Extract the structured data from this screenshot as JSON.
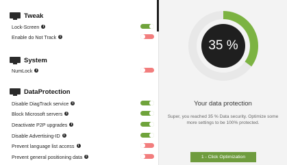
{
  "colors": {
    "toggle_on": "#6fa33b",
    "toggle_off": "#f27d7d",
    "gauge_track": "#e8e8e8",
    "gauge_fill": "#7cb342",
    "gauge_center": "#1f1f1f",
    "button": "#6f9c3e"
  },
  "icons": {
    "section": "monitor-icon",
    "info": "info-icon"
  },
  "sections": [
    {
      "title": "Tweak",
      "settings": [
        {
          "label": "Lock-Screen",
          "enabled": true
        },
        {
          "label": "Enable do Not Track",
          "enabled": false
        }
      ]
    },
    {
      "title": "System",
      "settings": [
        {
          "label": "NumLock",
          "enabled": false
        }
      ]
    },
    {
      "title": "DataProtection",
      "settings": [
        {
          "label": "Disable DiagTrack service",
          "enabled": true
        },
        {
          "label": "Block Microsoft servers",
          "enabled": true
        },
        {
          "label": "Deactivate P2P upgrades",
          "enabled": true
        },
        {
          "label": "Disable Advertising-ID",
          "enabled": true
        },
        {
          "label": "Prevent language list access",
          "enabled": false
        },
        {
          "label": "Prevent general positioning data",
          "enabled": false
        }
      ]
    }
  ],
  "protection": {
    "percent": 35,
    "percent_label": "35 %",
    "title": "Your data protection",
    "description": "Super, you reached 35 % Data security. Optimize some more settings to be 100% protected.",
    "button_label": "1 - Click Optimization"
  }
}
